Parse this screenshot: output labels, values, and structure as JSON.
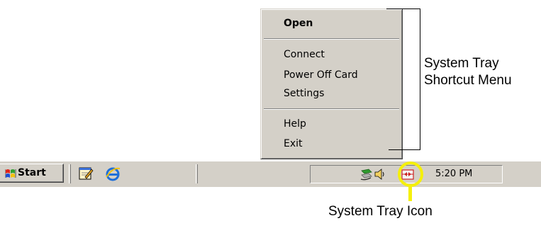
{
  "menu": {
    "items": [
      {
        "label": "Open",
        "default": true
      },
      {
        "label": "Connect"
      },
      {
        "label": "Power Off Card"
      },
      {
        "label": "Settings"
      },
      {
        "label": "Help"
      },
      {
        "label": "Exit"
      }
    ]
  },
  "callouts": {
    "menu_label_line1": "System Tray",
    "menu_label_line2": "Shortcut Menu",
    "icon_label": "System Tray Icon"
  },
  "taskbar": {
    "start_label": "Start",
    "quick_launch": [
      "notepad-icon",
      "internet-explorer-icon"
    ],
    "tray_icons": [
      "network-cable-icon",
      "speaker-volume-icon",
      "card-tray-icon"
    ],
    "clock": "5:20 PM"
  },
  "colors": {
    "highlight": "#f5f00a",
    "taskbar": "#d4d0c8"
  }
}
